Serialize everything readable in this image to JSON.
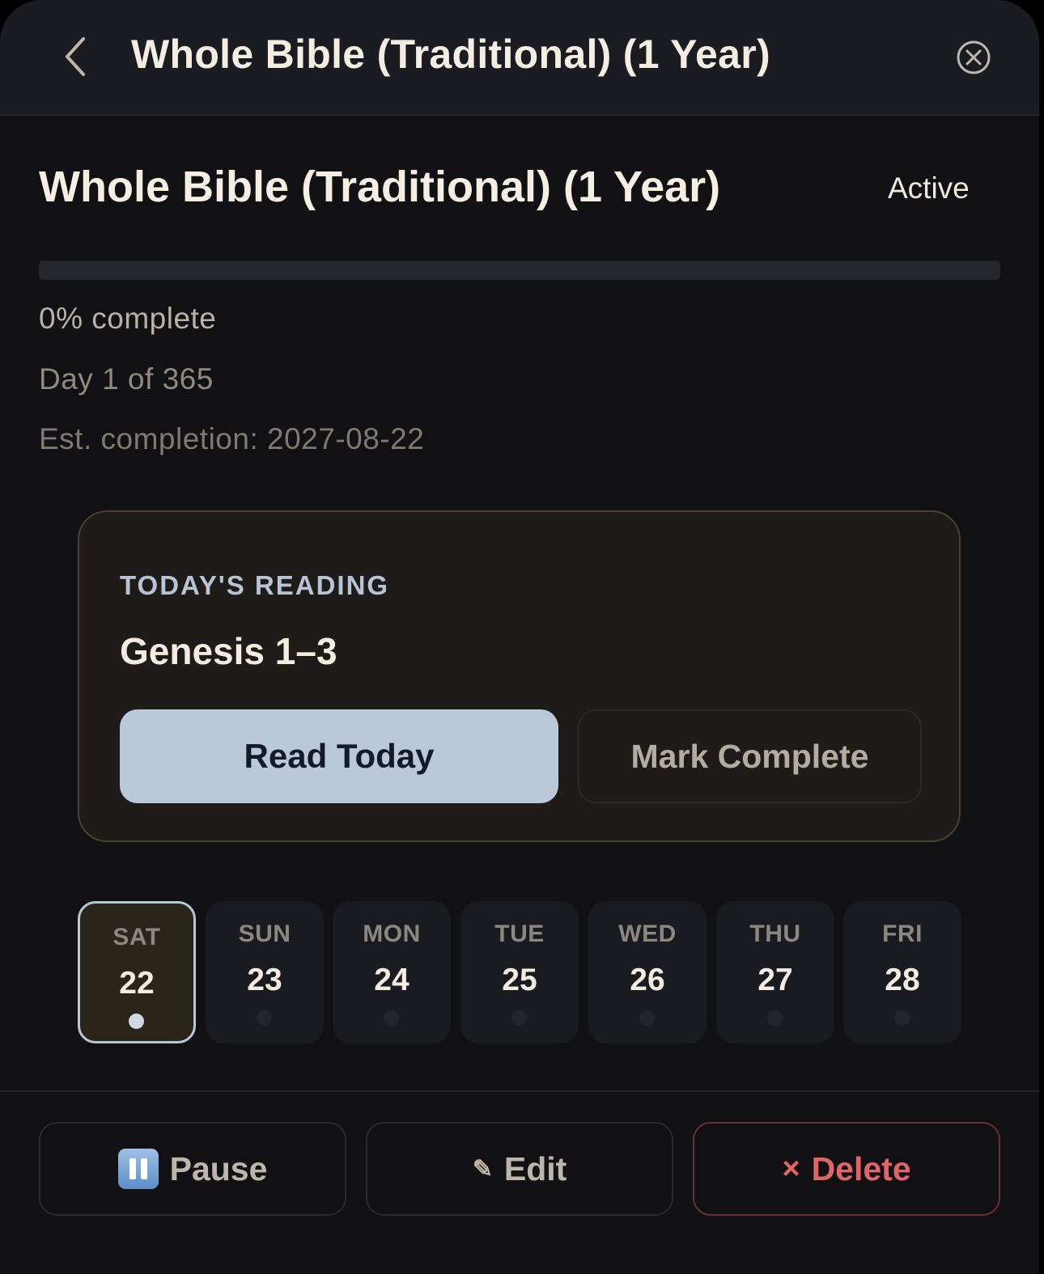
{
  "header": {
    "title": "Whole Bible (Traditional) (1 Year)",
    "back_icon": "chevron-left-icon",
    "close_icon": "close-circle-icon"
  },
  "plan": {
    "title": "Whole Bible (Traditional) (1 Year)",
    "status": "Active",
    "progress_fraction": 0,
    "percent_text": "0% complete",
    "day_text": "Day 1 of 365",
    "est_completion_text": "Est. completion: 2027-08-22"
  },
  "today": {
    "label": "TODAY'S READING",
    "passage": "Genesis 1–3",
    "read_button": "Read Today",
    "mark_button": "Mark Complete"
  },
  "week": [
    {
      "name": "SAT",
      "num": "22",
      "selected": true
    },
    {
      "name": "SUN",
      "num": "23",
      "selected": false
    },
    {
      "name": "MON",
      "num": "24",
      "selected": false
    },
    {
      "name": "TUE",
      "num": "25",
      "selected": false
    },
    {
      "name": "WED",
      "num": "26",
      "selected": false
    },
    {
      "name": "THU",
      "num": "27",
      "selected": false
    },
    {
      "name": "FRI",
      "num": "28",
      "selected": false
    }
  ],
  "actions": {
    "pause": "Pause",
    "edit": "Edit",
    "delete": "Delete",
    "pause_icon": "pause-button-icon",
    "edit_icon": "pencil-icon",
    "delete_icon": "x-icon"
  },
  "colors": {
    "accent": "#bbc8da",
    "danger": "#e06567",
    "card_border": "#4a4130"
  }
}
